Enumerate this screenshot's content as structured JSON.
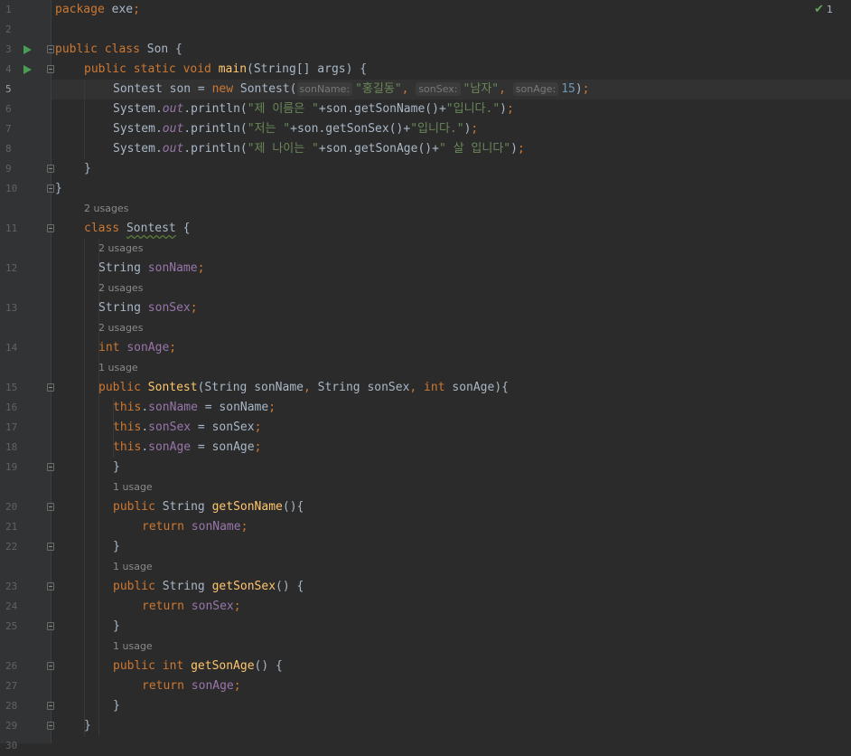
{
  "editor": {
    "inspection_count": "1",
    "lines": [
      {
        "n": "1",
        "tokens": [
          [
            "kw",
            "package "
          ],
          [
            "plain",
            "exe"
          ],
          [
            "kw",
            ";"
          ]
        ]
      },
      {
        "n": "2",
        "tokens": []
      },
      {
        "n": "3",
        "run": true,
        "fold": true,
        "tokens": [
          [
            "kw",
            "public class "
          ],
          [
            "plain",
            "Son {"
          ]
        ]
      },
      {
        "n": "4",
        "run": true,
        "fold": true,
        "indent": 1,
        "tokens": [
          [
            "kw",
            "public static void "
          ],
          [
            "fn",
            "main"
          ],
          [
            "plain",
            "(String[] args) {"
          ]
        ]
      },
      {
        "n": "5",
        "current": true,
        "indent": 2,
        "tokens": [
          [
            "plain",
            "Sontest son = "
          ],
          [
            "kw",
            "new "
          ],
          [
            "plain",
            "Sontest("
          ],
          [
            "hint",
            "sonName:"
          ],
          [
            "str",
            "\"홍길동\""
          ],
          [
            "kw",
            ", "
          ],
          [
            "hint",
            "sonSex:"
          ],
          [
            "str",
            "\"남자\""
          ],
          [
            "kw",
            ", "
          ],
          [
            "hint",
            "sonAge:"
          ],
          [
            "num",
            "15"
          ],
          [
            "plain",
            ")"
          ],
          [
            "kw",
            ";"
          ]
        ]
      },
      {
        "n": "6",
        "indent": 2,
        "tokens": [
          [
            "plain",
            "System."
          ],
          [
            "static",
            "out"
          ],
          [
            "plain",
            ".println("
          ],
          [
            "str",
            "\"제 이름은 \""
          ],
          [
            "plain",
            "+son.getSonName()+"
          ],
          [
            "str",
            "\"입니다.\""
          ],
          [
            "plain",
            ")"
          ],
          [
            "kw",
            ";"
          ]
        ]
      },
      {
        "n": "7",
        "indent": 2,
        "tokens": [
          [
            "plain",
            "System."
          ],
          [
            "static",
            "out"
          ],
          [
            "plain",
            ".println("
          ],
          [
            "str",
            "\"저는 \""
          ],
          [
            "plain",
            "+son.getSonSex()+"
          ],
          [
            "str",
            "\"입니다.\""
          ],
          [
            "plain",
            ")"
          ],
          [
            "kw",
            ";"
          ]
        ]
      },
      {
        "n": "8",
        "indent": 2,
        "tokens": [
          [
            "plain",
            "System."
          ],
          [
            "static",
            "out"
          ],
          [
            "plain",
            ".println("
          ],
          [
            "str",
            "\"제 나이는 \""
          ],
          [
            "plain",
            "+son.getSonAge()+"
          ],
          [
            "str",
            "\" 살 입니다\""
          ],
          [
            "plain",
            ")"
          ],
          [
            "kw",
            ";"
          ]
        ]
      },
      {
        "n": "9",
        "fold": true,
        "indent": 1,
        "tokens": [
          [
            "plain",
            "}"
          ]
        ]
      },
      {
        "n": "10",
        "fold": true,
        "tokens": [
          [
            "plain",
            "}"
          ]
        ]
      },
      {
        "usage": "2 usages",
        "uindent": 1
      },
      {
        "n": "11",
        "fold": true,
        "indent": 1,
        "tokens": [
          [
            "kw",
            "class "
          ],
          [
            "uline",
            "Sontest"
          ],
          [
            "plain",
            " {"
          ]
        ]
      },
      {
        "usage": "2 usages",
        "uindent": 1.5
      },
      {
        "n": "12",
        "indent": 1.5,
        "tokens": [
          [
            "plain",
            "String "
          ],
          [
            "field",
            "sonName"
          ],
          [
            "kw",
            ";"
          ]
        ]
      },
      {
        "usage": "2 usages",
        "uindent": 1.5
      },
      {
        "n": "13",
        "indent": 1.5,
        "tokens": [
          [
            "plain",
            "String "
          ],
          [
            "field",
            "sonSex"
          ],
          [
            "kw",
            ";"
          ]
        ]
      },
      {
        "usage": "2 usages",
        "uindent": 1.5
      },
      {
        "n": "14",
        "indent": 1.5,
        "tokens": [
          [
            "kw",
            "int "
          ],
          [
            "field",
            "sonAge"
          ],
          [
            "kw",
            ";"
          ]
        ]
      },
      {
        "usage": "1 usage",
        "uindent": 1.5
      },
      {
        "n": "15",
        "fold": true,
        "indent": 1.5,
        "tokens": [
          [
            "kw",
            "public "
          ],
          [
            "fn",
            "Sontest"
          ],
          [
            "plain",
            "(String sonName"
          ],
          [
            "kw",
            ", "
          ],
          [
            "plain",
            "String sonSex"
          ],
          [
            "kw",
            ", int "
          ],
          [
            "plain",
            "sonAge){"
          ]
        ]
      },
      {
        "n": "16",
        "indent": 2,
        "tokens": [
          [
            "kw",
            "this"
          ],
          [
            "plain",
            "."
          ],
          [
            "field",
            "sonName"
          ],
          [
            "plain",
            " = sonName"
          ],
          [
            "kw",
            ";"
          ]
        ]
      },
      {
        "n": "17",
        "indent": 2,
        "tokens": [
          [
            "kw",
            "this"
          ],
          [
            "plain",
            "."
          ],
          [
            "field",
            "sonSex"
          ],
          [
            "plain",
            " = sonSex"
          ],
          [
            "kw",
            ";"
          ]
        ]
      },
      {
        "n": "18",
        "indent": 2,
        "tokens": [
          [
            "kw",
            "this"
          ],
          [
            "plain",
            "."
          ],
          [
            "field",
            "sonAge"
          ],
          [
            "plain",
            " = sonAge"
          ],
          [
            "kw",
            ";"
          ]
        ]
      },
      {
        "n": "19",
        "fold": true,
        "indent": 2,
        "tokens": [
          [
            "plain",
            "}"
          ]
        ]
      },
      {
        "usage": "1 usage",
        "uindent": 2
      },
      {
        "n": "20",
        "fold": true,
        "indent": 2,
        "tokens": [
          [
            "kw",
            "public "
          ],
          [
            "plain",
            "String "
          ],
          [
            "fn",
            "getSonName"
          ],
          [
            "plain",
            "(){"
          ]
        ]
      },
      {
        "n": "21",
        "indent": 3,
        "tokens": [
          [
            "kw",
            "return "
          ],
          [
            "field",
            "sonName"
          ],
          [
            "kw",
            ";"
          ]
        ]
      },
      {
        "n": "22",
        "fold": true,
        "indent": 2,
        "tokens": [
          [
            "plain",
            "}"
          ]
        ]
      },
      {
        "usage": "1 usage",
        "uindent": 2
      },
      {
        "n": "23",
        "fold": true,
        "indent": 2,
        "tokens": [
          [
            "kw",
            "public "
          ],
          [
            "plain",
            "String "
          ],
          [
            "fn",
            "getSonSex"
          ],
          [
            "plain",
            "() {"
          ]
        ]
      },
      {
        "n": "24",
        "indent": 3,
        "tokens": [
          [
            "kw",
            "return "
          ],
          [
            "field",
            "sonSex"
          ],
          [
            "kw",
            ";"
          ]
        ]
      },
      {
        "n": "25",
        "fold": true,
        "indent": 2,
        "tokens": [
          [
            "plain",
            "}"
          ]
        ]
      },
      {
        "usage": "1 usage",
        "uindent": 2
      },
      {
        "n": "26",
        "fold": true,
        "indent": 2,
        "tokens": [
          [
            "kw",
            "public int "
          ],
          [
            "fn",
            "getSonAge"
          ],
          [
            "plain",
            "() {"
          ]
        ]
      },
      {
        "n": "27",
        "indent": 3,
        "tokens": [
          [
            "kw",
            "return "
          ],
          [
            "field",
            "sonAge"
          ],
          [
            "kw",
            ";"
          ]
        ]
      },
      {
        "n": "28",
        "fold": true,
        "indent": 2,
        "tokens": [
          [
            "plain",
            "}"
          ]
        ]
      },
      {
        "n": "29",
        "fold": true,
        "indent": 1,
        "tokens": [
          [
            "plain",
            "}"
          ]
        ]
      },
      {
        "n": "30",
        "tokens": []
      }
    ]
  }
}
